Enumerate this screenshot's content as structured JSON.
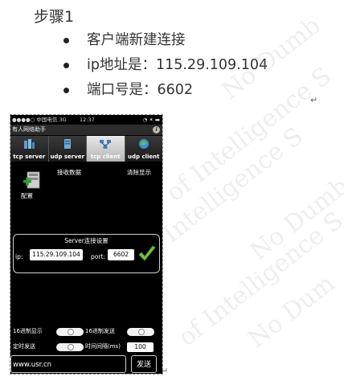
{
  "doc": {
    "step_title": "步骤1",
    "bullets": [
      {
        "text": "客户端新建连接"
      },
      {
        "text": "ip地址是：115.29.109.104"
      },
      {
        "text": "端口号是：6602"
      }
    ],
    "return_mark": "↵"
  },
  "watermark": {
    "lines": [
      "of Intelligence S",
      "No Dumb",
      "of Intelligence S",
      "No Dumb",
      "of Intelligence S",
      "No Dum"
    ]
  },
  "phone": {
    "status": {
      "carrier": "●●●●○ 中国电信  3G",
      "time": "12:37",
      "right": "◔ ✶ ▬"
    },
    "app_title": "有人网络助手",
    "info_icon": "i",
    "tabs": [
      {
        "label": "tcp server",
        "icon": "tcp-server-icon",
        "active": false
      },
      {
        "label": "udp server",
        "icon": "udp-server-icon",
        "active": false
      },
      {
        "label": "tcp client",
        "icon": "tcp-client-icon",
        "active": true
      },
      {
        "label": "udp client",
        "icon": "udp-client-icon",
        "active": false
      }
    ],
    "config_label": "配置",
    "receive_label": "接收数据",
    "clear_label": "清除显示",
    "server_settings": {
      "title": "Server连接设置",
      "ip_label": "ip:",
      "ip_value": "115.29.109.104",
      "port_label": "port:",
      "port_value": "6602"
    },
    "options": {
      "hex_display": "16进制显示",
      "hex_send": "16进制发送",
      "timed_send": "定时发送",
      "interval_label": "时间间隔(ms)",
      "interval_value": "100"
    },
    "url_value": "www.usr.cn",
    "send_label": "发送"
  },
  "colors": {
    "check_green": "#7ac143",
    "phone_bg": "#000000",
    "tab_active": "#d0d0d0"
  }
}
